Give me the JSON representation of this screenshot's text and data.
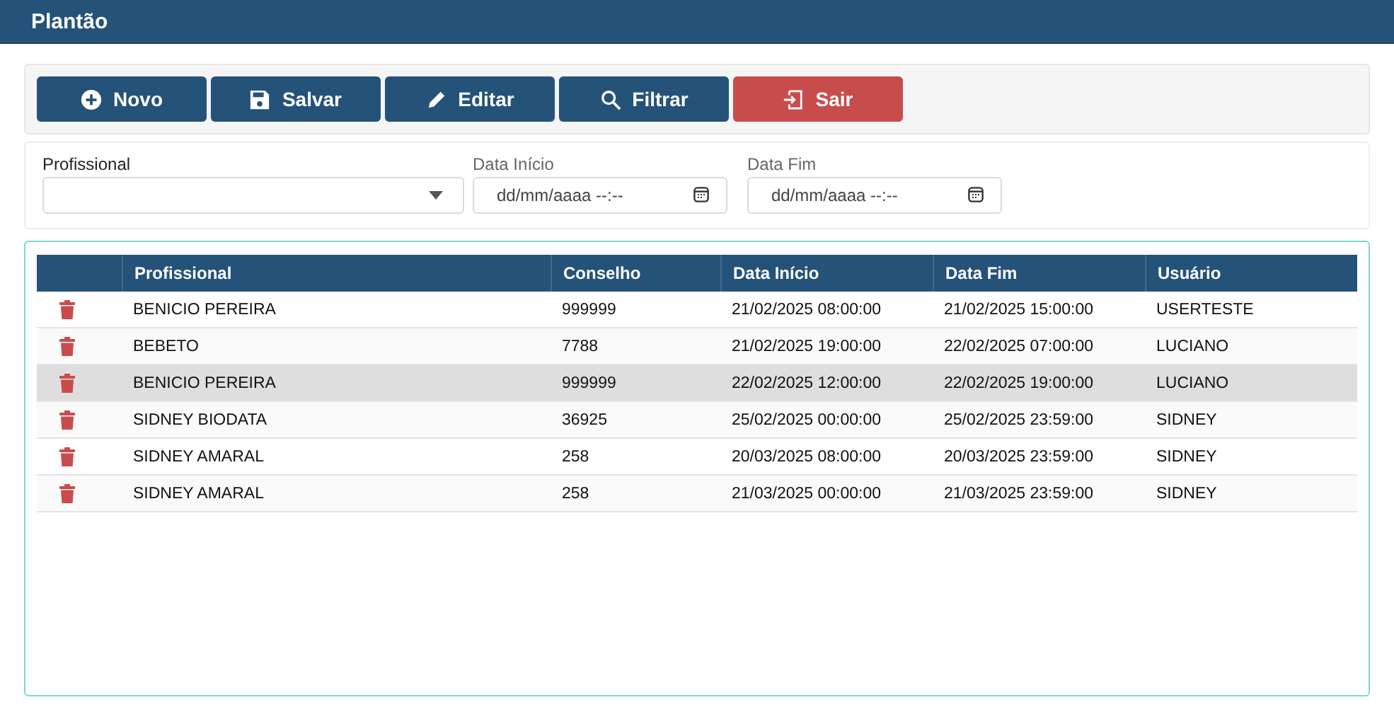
{
  "window": {
    "title": "Plantão"
  },
  "toolbar": [
    {
      "label": "Novo",
      "kind": "primary"
    },
    {
      "label": "Salvar",
      "kind": "primary"
    },
    {
      "label": "Editar",
      "kind": "primary"
    },
    {
      "label": "Filtrar",
      "kind": "primary"
    },
    {
      "label": "Sair",
      "kind": "danger"
    }
  ],
  "filters": {
    "profissional": {
      "label": "Profissional"
    },
    "data_inicio": {
      "label": "Data Início",
      "placeholder": "dd/mm/aaaa --:--"
    },
    "data_fim": {
      "label": "Data Fim",
      "placeholder": "dd/mm/aaaa --:--"
    }
  },
  "table": {
    "columns": [
      "Profissional",
      "Conselho",
      "Data Início",
      "Data Fim",
      "Usuário"
    ],
    "rows": [
      {
        "cells": [
          "BENICIO PEREIRA",
          "999999",
          "21/02/2025 08:00:00",
          "21/02/2025 15:00:00",
          "USERTESTE"
        ],
        "selected": false
      },
      {
        "cells": [
          "BEBETO",
          "7788",
          "21/02/2025 19:00:00",
          "22/02/2025 07:00:00",
          "LUCIANO"
        ],
        "selected": false
      },
      {
        "cells": [
          "BENICIO PEREIRA",
          "999999",
          "22/02/2025 12:00:00",
          "22/02/2025 19:00:00",
          "LUCIANO"
        ],
        "selected": true
      },
      {
        "cells": [
          "SIDNEY BIODATA",
          "36925",
          "25/02/2025 00:00:00",
          "25/02/2025 23:59:00",
          "SIDNEY"
        ],
        "selected": false
      },
      {
        "cells": [
          "SIDNEY AMARAL",
          "258",
          "20/03/2025 08:00:00",
          "20/03/2025 23:59:00",
          "SIDNEY"
        ],
        "selected": false
      },
      {
        "cells": [
          "SIDNEY AMARAL",
          "258",
          "21/03/2025 00:00:00",
          "21/03/2025 23:59:00",
          "SIDNEY"
        ],
        "selected": false
      }
    ]
  }
}
